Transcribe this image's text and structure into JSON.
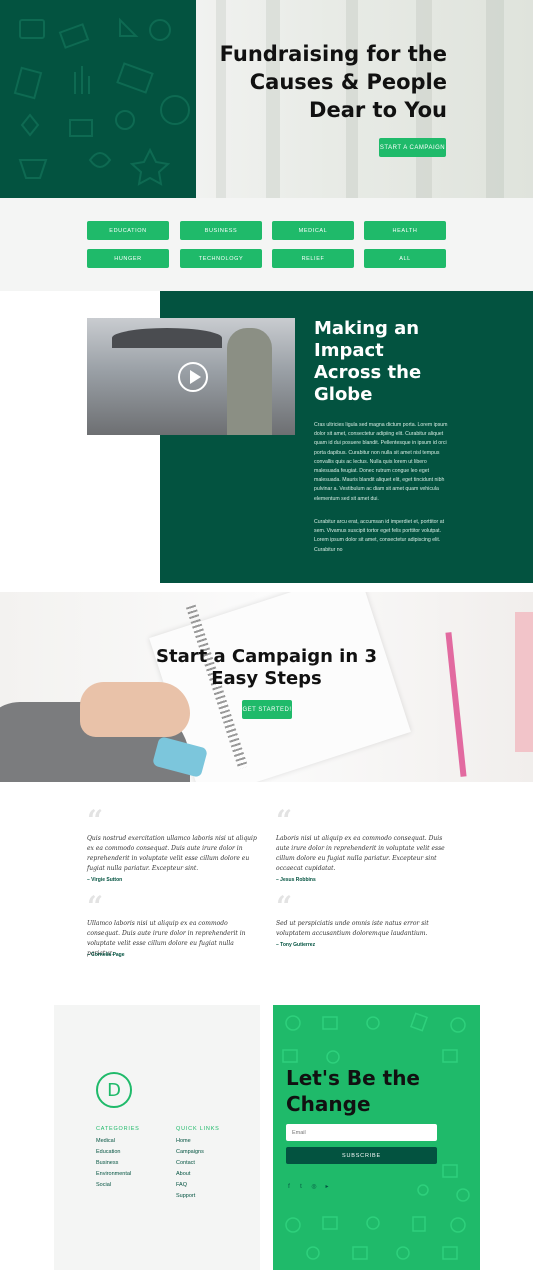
{
  "hero": {
    "title_lines": [
      "Fundraising for the",
      "Causes & People",
      "Dear to You"
    ],
    "cta": "Start a Campaign"
  },
  "categories": [
    "Education",
    "Business",
    "Medical",
    "Health",
    "Hunger",
    "Technology",
    "Relief",
    "All"
  ],
  "impact": {
    "title_lines": [
      "Making an",
      "Impact",
      "Across the",
      "Globe"
    ],
    "para1": "Cras ultricies ligula sed magna dictum porta. Lorem ipsum dolor sit amet, consectetur adipiing elit. Curabitur aliquet quam id dui posuere blandit. Pellentesque in ipsum id orci porta dapibus. Curabitur non nulla sit amet nisl tempus convallis quis ac lectus. Nulla quis lorem ut libero malesuada feugiat. Donec rutrum congue leo eget malesuada. Mauris blandit aliquet elit, eget tincidunt nibh pulvinar a. Vestibulum ac diam sit amet quam vehicula elementum sed sit amet dui.",
    "para2": "Curabitur arcu erat, accumsan id imperdiet et, porttitor at sem. Vivamus suscipit tortor eget felis porttitor volutpat. Lorem ipsum dolor sit amet, consectetur adipiscing elit. Curabitur no"
  },
  "steps": {
    "title_lines": [
      "Start a Campaign in 3",
      "Easy Steps"
    ],
    "cta": "Get Started!"
  },
  "testimonials": [
    {
      "quote": "Quis nostrud exercitation ullamco laboris nisi ut aliquip ex ea commodo consequat. Duis aute irure dolor in reprehenderit in voluptate velit esse cillum dolore eu fugiat nulla pariatur. Excepteur sint.",
      "author": "– Virgie Sutton"
    },
    {
      "quote": "Laboris nisi ut aliquip ex ea commodo consequat. Duis aute irure dolor in reprehenderit in voluptate velit esse cillum dolore eu fugiat nulla pariatur. Excepteur sint occaecat cupidatat.",
      "author": "– Jesus Robbins"
    },
    {
      "quote": "Ullamco laboris nisi ut aliquip ex ea commodo consequat. Duis aute irure dolor in reprehenderit in voluptate velit esse cillum dolore eu fugiat nulla pariatur.",
      "author": "– Cornelia Page"
    },
    {
      "quote": "Sed ut perspiciatis unde omnis iste natus error sit voluptatem accusantium doloremque laudantium.",
      "author": "– Tony Gutierrez"
    }
  ],
  "footer": {
    "logo_letter": "D",
    "categories_heading": "Categories",
    "categories": [
      "Medical",
      "Education",
      "Business",
      "Environmental",
      "Social"
    ],
    "quick_links_heading": "Quick Links",
    "quick_links": [
      "Home",
      "Campaigns",
      "Contact",
      "About",
      "FAQ",
      "Support"
    ],
    "cta_title_lines": [
      "Let's Be the",
      "Change"
    ],
    "email_placeholder": "Email",
    "subscribe": "Subscribe",
    "social_icons": [
      "facebook-icon",
      "twitter-icon",
      "instagram-icon",
      "youtube-icon"
    ]
  },
  "colors": {
    "dark_green": "#035340",
    "accent_green": "#1fba6a"
  }
}
